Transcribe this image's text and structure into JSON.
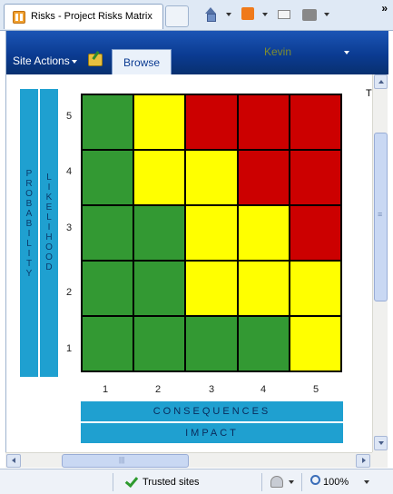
{
  "browser": {
    "tab_title": "Risks - Project Risks Matrix",
    "toolbar_chevron": "»"
  },
  "header": {
    "user_name": "Kevin",
    "site_actions_label": "Site Actions",
    "browse_tab_label": "Browse"
  },
  "matrix": {
    "probability_label": "PROBABILITY",
    "likelihood_label": "LIKELIHOOD",
    "y_labels": [
      "5",
      "4",
      "3",
      "2",
      "1"
    ],
    "x_labels": [
      "1",
      "2",
      "3",
      "4",
      "5"
    ],
    "rows": [
      [
        "green",
        "yellow",
        "red",
        "red",
        "red"
      ],
      [
        "green",
        "yellow",
        "yellow",
        "red",
        "red"
      ],
      [
        "green",
        "green",
        "yellow",
        "yellow",
        "red"
      ],
      [
        "green",
        "green",
        "yellow",
        "yellow",
        "yellow"
      ],
      [
        "green",
        "green",
        "green",
        "green",
        "yellow"
      ]
    ],
    "consequences_label": "CONSEQUENCES",
    "impact_label": "IMPACT",
    "colors": {
      "green": "#339933",
      "yellow": "#ffff00",
      "red": "#cc0000",
      "label_band": "#1fa0d0"
    },
    "corner_text": "T"
  },
  "status": {
    "zone": "Trusted sites",
    "zoom": "100%"
  }
}
